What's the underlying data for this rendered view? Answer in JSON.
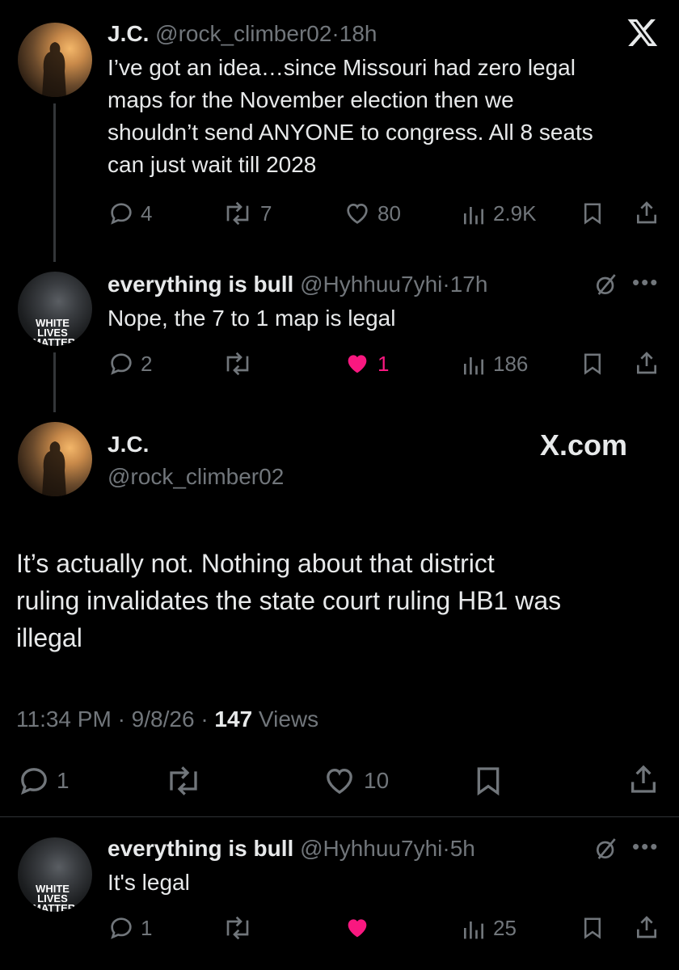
{
  "tweets": [
    {
      "name": "J.C.",
      "handle": "@rock_climber02",
      "time": "18h",
      "text": "I’ve got an idea…since Missouri had zero legal maps for the November election then we shouldn’t send ANYONE to congress. All 8 seats can just wait till 2028",
      "lines": [
        "I’ve got an idea…since Missouri had zero legal",
        "maps for the November election then we",
        "shouldn’t send ANYONE to congress. All 8 seats",
        "can just wait till 2028"
      ],
      "replies": "4",
      "reposts": "7",
      "likes": "80",
      "views": "2.9K"
    },
    {
      "name": "everything is bull",
      "handle": "@Hyhhuu7yhi",
      "time": "17h",
      "text": "Nope, the 7 to 1 map is legal",
      "avatar_text": [
        "WHITE",
        "LIVES",
        "MATTER"
      ],
      "replies": "2",
      "reposts": "",
      "likes": "1",
      "views": "186"
    },
    {
      "name": "everything is bull",
      "handle": "@Hyhhuu7yhi",
      "time": "5h",
      "text": "It's legal",
      "avatar_text": [
        "WHITE",
        "LIVES",
        "MATTER"
      ],
      "replies": "1",
      "reposts": "",
      "likes": "",
      "views": "25"
    }
  ],
  "main_tweet": {
    "name": "J.C.",
    "handle": "@rock_climber02",
    "brand": "X.com",
    "lines": [
      "It’s actually not. Nothing about that district",
      "ruling invalidates the state court ruling HB1 was",
      "illegal"
    ],
    "time": "11:34 PM",
    "date": "9/8/26",
    "views_count": "147",
    "views_label": "Views",
    "replies": "1",
    "likes": "10"
  },
  "separator": "·",
  "top_logo": "X",
  "colors": {
    "background": "#000000",
    "text": "#e7e9ea",
    "muted": "#71767b",
    "like_active": "#f91880"
  }
}
